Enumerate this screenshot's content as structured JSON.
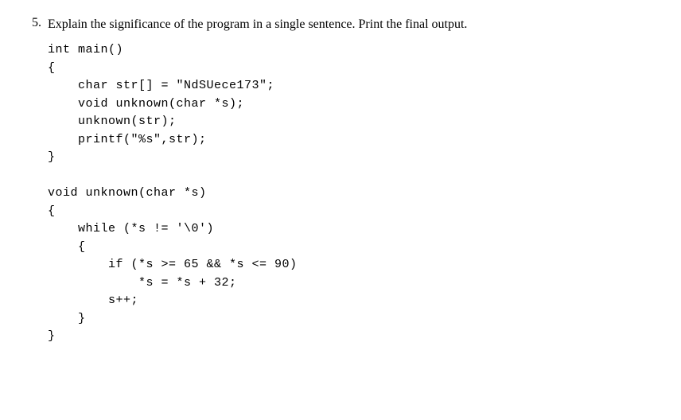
{
  "question": {
    "number": "5.",
    "prompt": "Explain the significance of the program in a single sentence. Print the final output."
  },
  "code": {
    "line1": "int main()",
    "line2": "{",
    "line3": "    char str[] = \"NdSUece173\";",
    "line4": "    void unknown(char *s);",
    "line5": "    unknown(str);",
    "line6": "    printf(\"%s\",str);",
    "line7": "}",
    "line8": "",
    "line9": "void unknown(char *s)",
    "line10": "{",
    "line11": "    while (*s != '\\0')",
    "line12": "    {",
    "line13": "        if (*s >= 65 && *s <= 90)",
    "line14": "            *s = *s + 32;",
    "line15": "        s++;",
    "line16": "    }",
    "line17": "}"
  }
}
